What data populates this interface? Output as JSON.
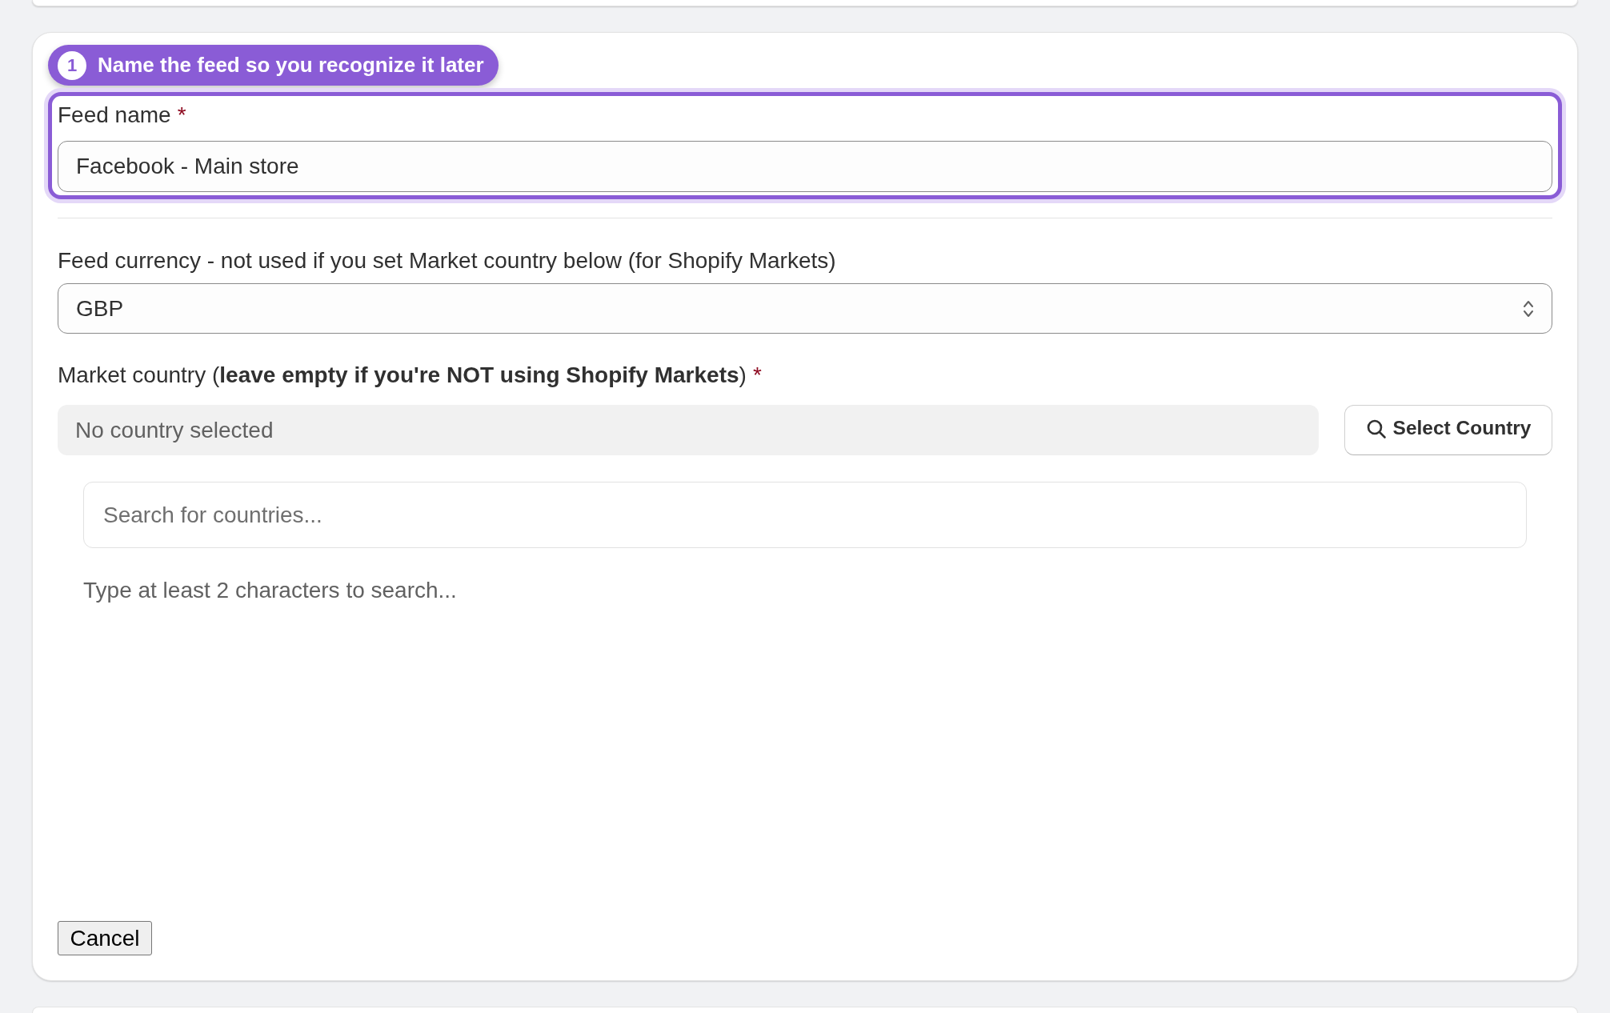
{
  "step_badge": {
    "number": "1",
    "title": "Name the feed so you recognize it later"
  },
  "feed_name": {
    "label": "Feed name",
    "required_mark": "*",
    "value": "Facebook - Main store",
    "highlighted": true
  },
  "feed_currency": {
    "label": "Feed currency - not used if you set Market country below (for Shopify Markets)",
    "value": "GBP"
  },
  "market_country": {
    "label": "Market country (**leave empty if you're NOT using Shopify Markets**)",
    "required_mark": "*",
    "selection": "No country selected",
    "button": "Select Country"
  },
  "country_search": {
    "placeholder": "Search for countries...",
    "hint": "Type at least 2 characters to search..."
  },
  "buttons": [
    "Cancel"
  ]
}
